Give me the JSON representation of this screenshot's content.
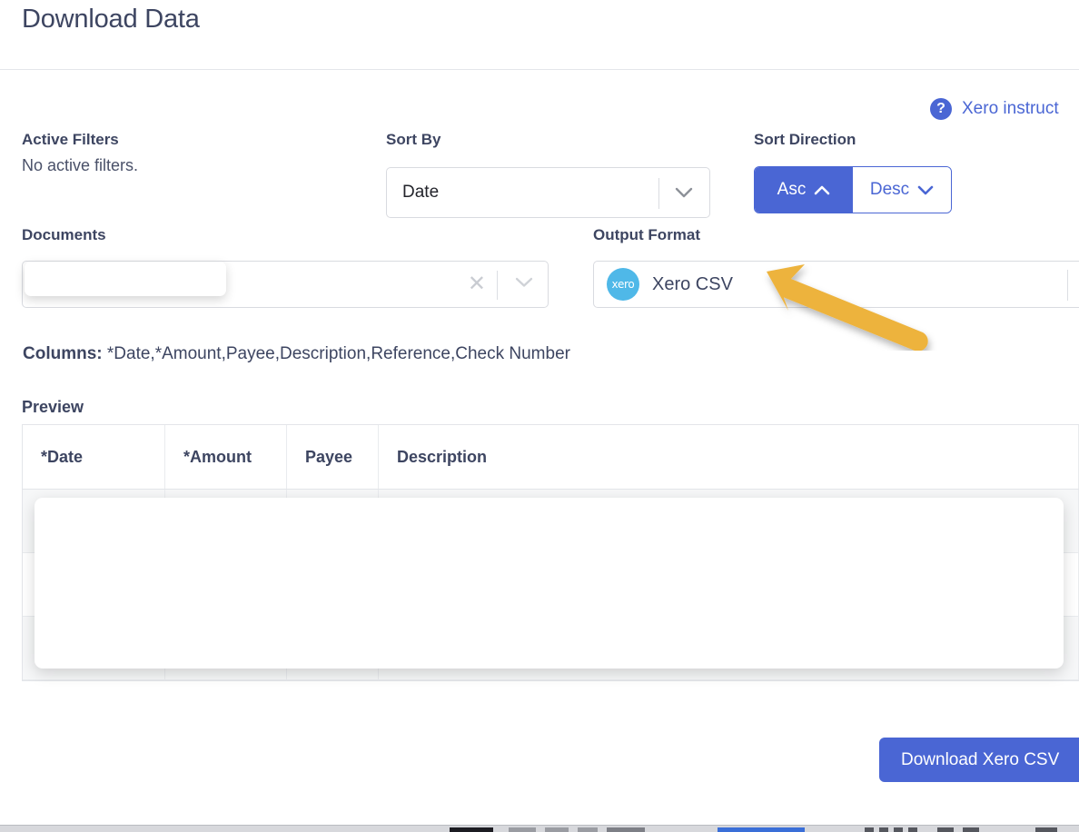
{
  "header": {
    "title": "Download Data"
  },
  "help": {
    "icon": "question-mark-circle-icon",
    "link_text": "Xero instruct"
  },
  "filters": {
    "label": "Active Filters",
    "value": "No active filters."
  },
  "sort_by": {
    "label": "Sort By",
    "value": "Date",
    "chevron_icon": "chevron-down-icon"
  },
  "sort_direction": {
    "label": "Sort Direction",
    "asc_label": "Asc",
    "desc_label": "Desc",
    "asc_icon": "chevron-up-icon",
    "desc_icon": "chevron-down-icon",
    "selected": "Asc"
  },
  "documents": {
    "label": "Documents",
    "value": "",
    "clear_icon": "close-x-icon",
    "chevron_icon": "chevron-down-icon"
  },
  "output_format": {
    "label": "Output Format",
    "value": "Xero CSV",
    "logo_text": "xero",
    "logo_color": "#4fb8e8"
  },
  "annotation": {
    "arrow_color": "#edb33e",
    "name": "arrow-pointing-to-output-format"
  },
  "columns": {
    "label": "Columns:",
    "value": "*Date,*Amount,Payee,Description,Reference,Check Number"
  },
  "preview": {
    "label": "Preview",
    "headers": [
      "*Date",
      "*Amount",
      "Payee",
      "Description"
    ],
    "rows": [
      [
        "",
        "",
        "",
        ""
      ],
      [
        "",
        "",
        "",
        ""
      ],
      [
        "",
        "",
        "",
        ""
      ]
    ],
    "clipped_text": "’"
  },
  "download_button": {
    "label": "Download Xero CSV",
    "color": "#4a66d4"
  },
  "theme": {
    "accent": "#4a66d4",
    "text": "#3d4561",
    "border": "#d9dbe0",
    "row_alt": "#f6f7f8"
  }
}
